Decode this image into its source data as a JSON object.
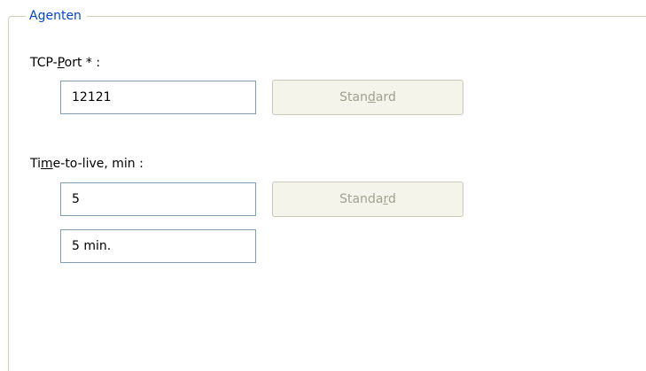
{
  "group": {
    "title": "Agenten"
  },
  "tcp_port": {
    "label": "TCP-Port * :",
    "value": "12121",
    "button_label": "Standard"
  },
  "ttl": {
    "label": "Time-to-live, min :",
    "value": "5",
    "button_label": "Standard",
    "display_value": "5 min."
  }
}
